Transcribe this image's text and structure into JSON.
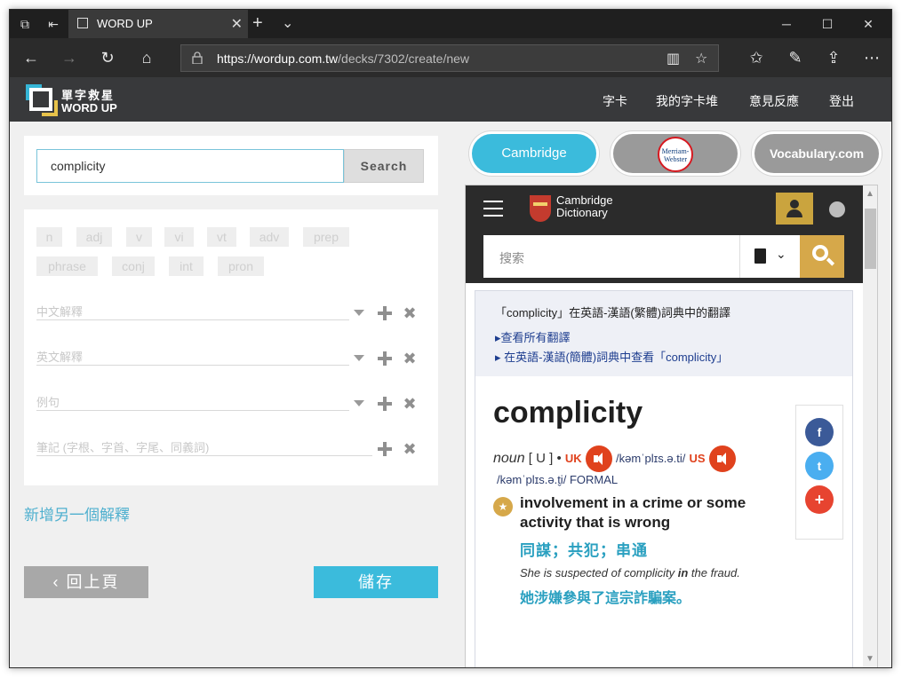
{
  "browser": {
    "tab_title": "WORD UP",
    "tab_close": "✕",
    "new_tab": "+",
    "url_host": "https://wordup.com.tw",
    "url_path": "/decks/7302/create/new",
    "icons": [
      "back-arrow-icon",
      "forward-arrow-icon",
      "refresh-icon",
      "home-icon",
      "lock-icon",
      "reading-view-icon",
      "favorite-star-icon",
      "favorites-list-icon",
      "pen-icon",
      "share-icon",
      "more-icon"
    ]
  },
  "site": {
    "logo_line1": "單字救星",
    "logo_line2": "WORD UP",
    "nav": [
      "字卡",
      "我的字卡堆",
      "意見反應",
      "登出"
    ],
    "colors": {
      "accent_blue": "#3bbbdc",
      "accent_yellow": "#e7c24a",
      "header_bg": "#38393b"
    }
  },
  "search": {
    "value": "complicity",
    "button": "Search"
  },
  "pos_tags": [
    "n",
    "adj",
    "v",
    "vi",
    "vt",
    "adv",
    "prep",
    "phrase",
    "conj",
    "int",
    "pron"
  ],
  "fields": [
    {
      "placeholder": "中文解釋"
    },
    {
      "placeholder": "英文解釋"
    },
    {
      "placeholder": "例句"
    },
    {
      "placeholder": "筆記 (字根、字首、字尾、同義詞)"
    }
  ],
  "add_definition": "新增另一個解釋",
  "back_button": "回上頁",
  "save_button": "儲存",
  "dict_tabs": {
    "cambridge": "Cambridge",
    "merriam_line1": "Merriam-",
    "merriam_line2": "Webster",
    "vocabulary": "Vocabulary.com"
  },
  "cambridge": {
    "brand_line1": "Cambridge",
    "brand_line2": "Dictionary",
    "search_placeholder": "搜索",
    "info_title": "「complicity」在英語-漢語(繁體)詞典中的翻譯",
    "info_link1": "▸查看所有翻譯",
    "info_link2": "▸ 在英語-漢語(簡體)詞典中查看「complicity」",
    "headword": "complicity",
    "pos": "noun",
    "grammar": "[ U ]",
    "dot": "•",
    "uk_label": "UK",
    "uk_pron": "/kəmˈplɪs.ə.ti/",
    "us_label": "US",
    "us_pron": "/kəmˈplɪs.ə.t̬i/",
    "register": "FORMAL",
    "definition": "involvement in a crime or some activity that is wrong",
    "translation": "同謀；共犯；串通",
    "example_pre": "She is suspected of complicity ",
    "example_bold": "in",
    "example_post": " the fraud.",
    "example_translation": "她涉嫌參與了這宗詐騙案。",
    "share": {
      "facebook": "f",
      "twitter": "t",
      "add": "+"
    }
  }
}
